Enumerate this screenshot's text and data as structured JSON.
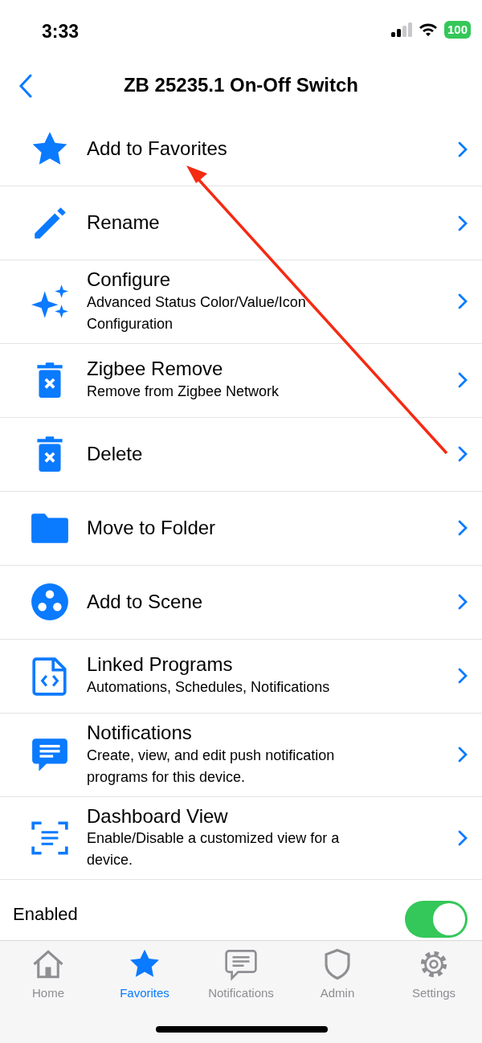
{
  "status_bar": {
    "time": "3:33",
    "battery": "100"
  },
  "nav": {
    "title": "ZB 25235.1 On-Off Switch"
  },
  "menu": [
    {
      "title": "Add to Favorites"
    },
    {
      "title": "Rename"
    },
    {
      "title": "Configure",
      "subtitle": "Advanced Status Color/Value/Icon Configuration"
    },
    {
      "title": "Zigbee Remove",
      "subtitle": "Remove from Zigbee Network"
    },
    {
      "title": "Delete"
    },
    {
      "title": "Move to Folder"
    },
    {
      "title": "Add to Scene"
    },
    {
      "title": "Linked Programs",
      "subtitle": "Automations, Schedules, Notifications"
    },
    {
      "title": "Notifications",
      "subtitle": "Create, view, and edit push notification programs for this device."
    },
    {
      "title": "Dashboard View",
      "subtitle": "Enable/Disable a customized view for a device."
    }
  ],
  "enabled_row": {
    "label": "Enabled",
    "on": true
  },
  "tabs": [
    {
      "label": "Home",
      "selected": false
    },
    {
      "label": "Favorites",
      "selected": true
    },
    {
      "label": "Notifications",
      "selected": false
    },
    {
      "label": "Admin",
      "selected": false
    },
    {
      "label": "Settings",
      "selected": false
    }
  ]
}
